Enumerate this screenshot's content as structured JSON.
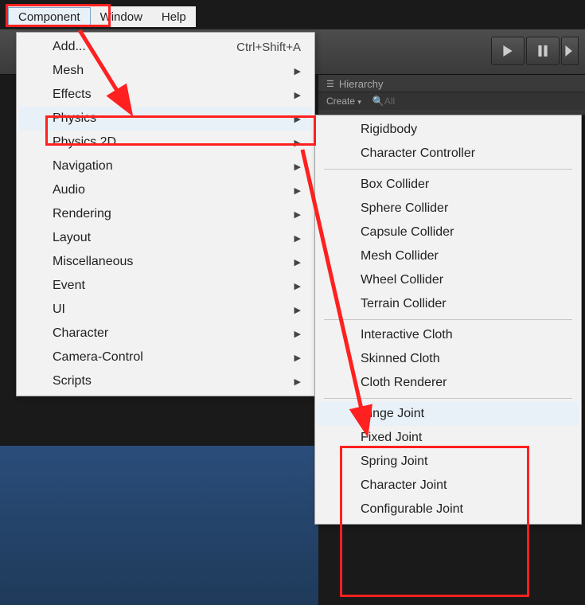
{
  "menubar": {
    "component": "Component",
    "window": "Window",
    "help": "Help"
  },
  "toolbar": {
    "play_icon": "play",
    "pause_icon": "pause",
    "step_icon": "step"
  },
  "hierarchy": {
    "label": "Hierarchy",
    "create": "Create",
    "all": "All"
  },
  "component_menu": {
    "add": {
      "label": "Add...",
      "shortcut": "Ctrl+Shift+A"
    },
    "items": [
      {
        "label": "Mesh"
      },
      {
        "label": "Effects"
      },
      {
        "label": "Physics"
      },
      {
        "label": "Physics 2D"
      },
      {
        "label": "Navigation"
      },
      {
        "label": "Audio"
      },
      {
        "label": "Rendering"
      },
      {
        "label": "Layout"
      },
      {
        "label": "Miscellaneous"
      },
      {
        "label": "Event"
      },
      {
        "label": "UI"
      },
      {
        "label": "Character"
      },
      {
        "label": "Camera-Control"
      },
      {
        "label": "Scripts"
      }
    ]
  },
  "physics_submenu": {
    "group1": [
      {
        "label": "Rigidbody"
      },
      {
        "label": "Character Controller"
      }
    ],
    "group2": [
      {
        "label": "Box Collider"
      },
      {
        "label": "Sphere Collider"
      },
      {
        "label": "Capsule Collider"
      },
      {
        "label": "Mesh Collider"
      },
      {
        "label": "Wheel Collider"
      },
      {
        "label": "Terrain Collider"
      }
    ],
    "group3": [
      {
        "label": "Interactive Cloth"
      },
      {
        "label": "Skinned Cloth"
      },
      {
        "label": "Cloth Renderer"
      }
    ],
    "group4": [
      {
        "label": "Hinge Joint"
      },
      {
        "label": "Fixed Joint"
      },
      {
        "label": "Spring Joint"
      },
      {
        "label": "Character Joint"
      },
      {
        "label": "Configurable Joint"
      }
    ]
  },
  "annotation": {
    "highlight_color": "#ff2020"
  }
}
